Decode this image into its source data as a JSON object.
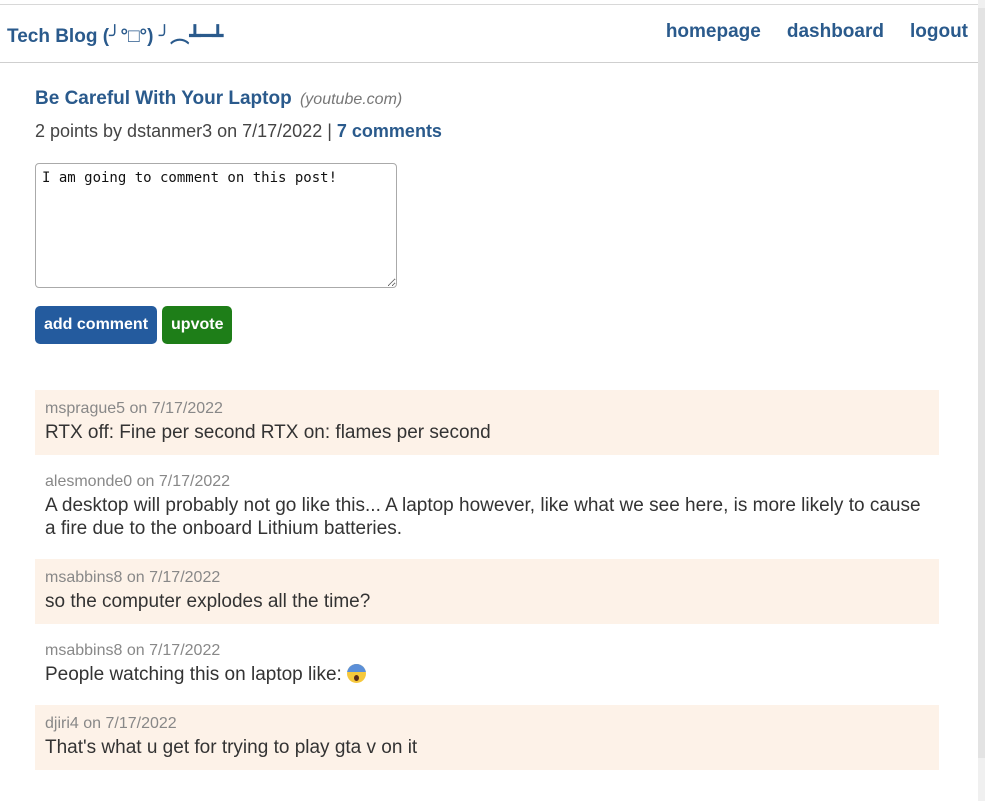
{
  "header": {
    "site_title": "Tech Blog (╯°□°) ╯︵┻━┻",
    "nav": [
      "homepage",
      "dashboard",
      "logout"
    ]
  },
  "post": {
    "title": "Be Careful With Your Laptop",
    "domain": "(youtube.com)",
    "meta_prefix": "2 points by dstanmer3 on 7/17/2022 |",
    "comments_link": "7 comments"
  },
  "comment_form": {
    "value": "I am going to comment on this post!",
    "add_label": "add comment",
    "upvote_label": "upvote"
  },
  "colors": {
    "link": "#2a5a8c",
    "primary_button": "#245b9e",
    "upvote_button": "#1e7e18",
    "alt_comment_bg": "#fdf2e8"
  },
  "comments": [
    {
      "meta": "msprague5 on 7/17/2022",
      "text": "RTX off: Fine per second RTX on: flames per second"
    },
    {
      "meta": "alesmonde0 on 7/17/2022",
      "text": "A desktop will probably not go like this... A laptop however, like what we see here, is more likely to cause a fire due to the onboard Lithium batteries."
    },
    {
      "meta": "msabbins8 on 7/17/2022",
      "text": "so the computer explodes all the time?"
    },
    {
      "meta": "msabbins8 on 7/17/2022",
      "text": "People watching this on laptop like:",
      "emoji": "scream-emoji"
    },
    {
      "meta": "djiri4 on 7/17/2022",
      "text": "That's what u get for trying to play gta v on it"
    }
  ]
}
